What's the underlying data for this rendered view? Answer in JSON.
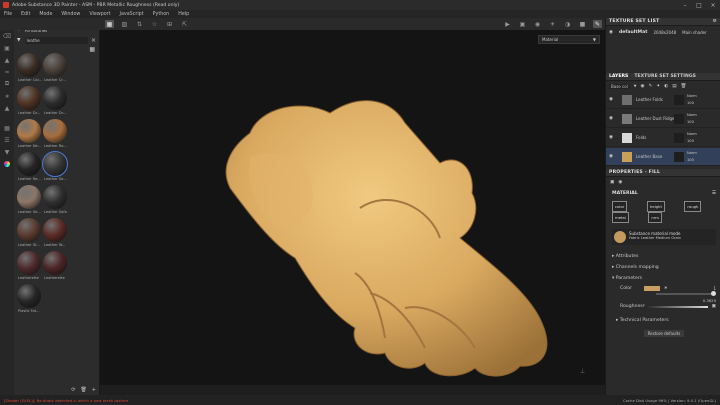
{
  "window": {
    "title": "Adobe Substance 3D Painter - ASM - PBR Metallic Roughness (Read only)"
  },
  "menu": [
    "File",
    "Edit",
    "Mode",
    "Window",
    "Viewport",
    "JavaScript",
    "Python",
    "Help"
  ],
  "assets": {
    "title": "ASSETS",
    "filter": "All libraries",
    "search": "leathe",
    "items": [
      {
        "label": "Leather Cal...",
        "color": "#3a2c24"
      },
      {
        "label": "Leather Cr...",
        "color": "#4a4039"
      },
      {
        "label": "Leather Dr...",
        "color": "#503424"
      },
      {
        "label": "Leather Dr...",
        "color": "#2b2b2b"
      },
      {
        "label": "Leather Ne...",
        "color": "#b07a48"
      },
      {
        "label": "Leather Ro...",
        "color": "#a76e3e"
      },
      {
        "label": "Leather Re...",
        "color": "#242424"
      },
      {
        "label": "Leather Se...",
        "color": "#353535"
      },
      {
        "label": "Leather Se...",
        "color": "#8c7667"
      },
      {
        "label": "Leather Sofa",
        "color": "#2f2f2f"
      },
      {
        "label": "Leather St...",
        "color": "#5a3b30"
      },
      {
        "label": "Leather W...",
        "color": "#5c2a26"
      },
      {
        "label": "Leatherette",
        "color": "#4e2a2c"
      },
      {
        "label": "Leatherette",
        "color": "#4d2526"
      },
      {
        "label": "Plastic Fat...",
        "color": "#262626"
      }
    ]
  },
  "viewport": {
    "mode": "Material"
  },
  "texture_set_list": {
    "title": "TEXTURE SET LIST",
    "name": "defaultMat",
    "size": "2048x2048",
    "shader": "Main shader"
  },
  "layers": {
    "tabs": [
      "LAYERS",
      "TEXTURE SET SETTINGS"
    ],
    "channel": "Base col",
    "items": [
      {
        "name": "Leather Folds",
        "blend": "Norm",
        "opacity": "100",
        "color": "#6e6e6e"
      },
      {
        "name": "Leather Dust Ridge",
        "blend": "Norm",
        "opacity": "100",
        "color": "#7a7a7a"
      },
      {
        "name": "Folds",
        "blend": "Norm",
        "opacity": "100",
        "color": "#d8d8d8"
      },
      {
        "name": "Leather Base",
        "blend": "Norm",
        "opacity": "100",
        "color": "#c9a05a"
      }
    ]
  },
  "properties": {
    "title": "PROPERTIES - FILL",
    "material_label": "MATERIAL",
    "chips": [
      "color",
      "height",
      "rough",
      "metal",
      "nrm"
    ],
    "substance_title": "Substance material mode",
    "substance_sub": "Fabric Leather Medium Grain",
    "sections": [
      "Attributes",
      "Channels mapping",
      "Parameters"
    ],
    "color_label": "Color",
    "color_value": "#c9a063",
    "color_value_text": "1",
    "roughness_label": "Roughness",
    "roughness_value": "0.3629",
    "tech_params": "Technical Parameters",
    "reset_label": "Restore defaults"
  },
  "status": {
    "left": "[Shader (GLSL)]: No direct detected in which a new mesh texture",
    "right": "Cache Disk Usage   96% | Version: 9.0.1 (OpenGL)"
  }
}
